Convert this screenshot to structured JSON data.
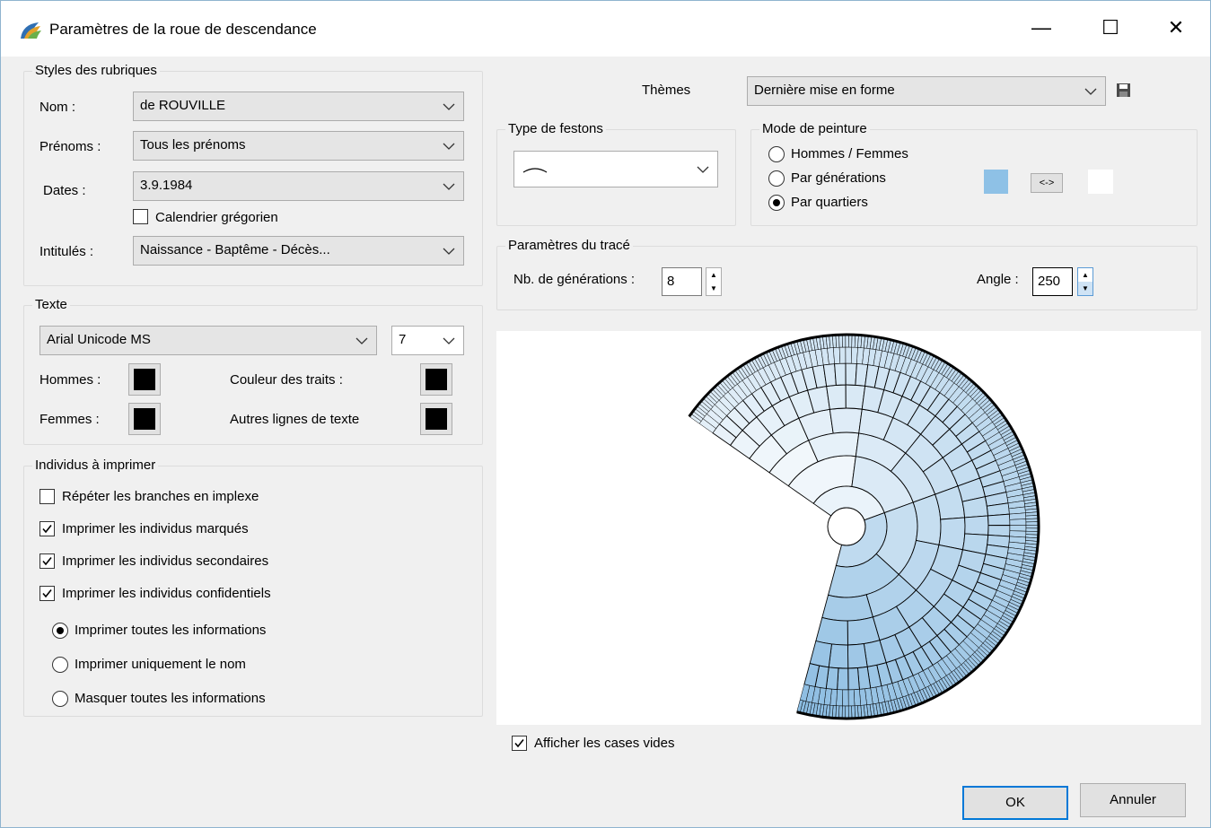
{
  "window": {
    "title": "Paramètres de la roue de descendance",
    "controls": {
      "minimize": "—",
      "maximize": "☐",
      "close": "✕"
    }
  },
  "rubriques": {
    "legend": "Styles des rubriques",
    "nom_label": "Nom :",
    "nom_value": "de ROUVILLE",
    "prenoms_label": "Prénoms :",
    "prenoms_value": "Tous les prénoms",
    "dates_label": "Dates :",
    "dates_value": "3.9.1984",
    "calendrier_label": "Calendrier grégorien",
    "calendrier_checked": false,
    "intitules_label": "Intitulés :",
    "intitules_value": "Naissance - Baptême - Décès..."
  },
  "texte": {
    "legend": "Texte",
    "font_value": "Arial Unicode MS",
    "size_value": "7",
    "hommes_label": "Hommes :",
    "femmes_label": "Femmes :",
    "traits_label": "Couleur des traits :",
    "autres_label": "Autres lignes de texte",
    "colors": {
      "hommes": "#000000",
      "femmes": "#000000",
      "traits": "#000000",
      "autres": "#000000"
    }
  },
  "individus": {
    "legend": "Individus à imprimer",
    "checks": [
      {
        "label": "Répéter les branches en implexe",
        "checked": false
      },
      {
        "label": "Imprimer les individus marqués",
        "checked": true
      },
      {
        "label": "Imprimer les individus secondaires",
        "checked": true
      },
      {
        "label": "Imprimer les individus confidentiels",
        "checked": true
      }
    ],
    "radios": [
      {
        "label": "Imprimer toutes les informations",
        "selected": true
      },
      {
        "label": "Imprimer uniquement le nom",
        "selected": false
      },
      {
        "label": "Masquer toutes les informations",
        "selected": false
      }
    ]
  },
  "themes": {
    "label": "Thèmes",
    "value": "Dernière mise en forme"
  },
  "festons": {
    "legend": "Type de festons"
  },
  "peinture": {
    "legend": "Mode de peinture",
    "options": [
      {
        "label": "Hommes / Femmes",
        "selected": false
      },
      {
        "label": "Par générations",
        "selected": false
      },
      {
        "label": "Par quartiers",
        "selected": true
      }
    ],
    "swap_label": "<->",
    "color_start": "#8ec1e6",
    "color_end": "#ffffff"
  },
  "trace": {
    "legend": "Paramètres du tracé",
    "generations_label": "Nb. de générations :",
    "generations_value": "8",
    "angle_label": "Angle :",
    "angle_value": "250"
  },
  "preview": {
    "generations": 8,
    "angle": 250,
    "color_light": "#ffffff",
    "color_dark": "#86b9e0",
    "line_color": "#000000"
  },
  "afficher": {
    "label": "Afficher les cases vides",
    "checked": true
  },
  "buttons": {
    "ok": "OK",
    "cancel": "Annuler"
  }
}
